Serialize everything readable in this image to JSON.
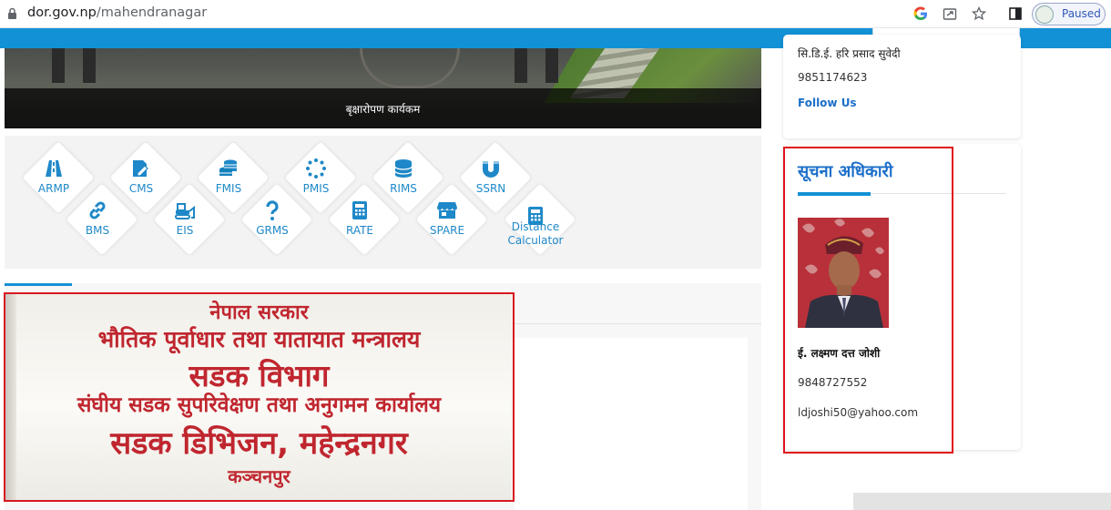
{
  "browser": {
    "url_host": "dor.gov.np",
    "url_path": "/mahendranagar",
    "profile_status": "Paused",
    "icons": [
      "lock-icon",
      "google-icon",
      "share-icon",
      "star-icon",
      "sidebar-icon",
      "profile-avatar"
    ]
  },
  "banner": {
    "caption": "बृक्षारोपण कार्यकम"
  },
  "links": [
    {
      "label": "ARMP",
      "icon": "road-icon"
    },
    {
      "label": "CMS",
      "icon": "edit-document-icon"
    },
    {
      "label": "FMIS",
      "icon": "coins-icon"
    },
    {
      "label": "PMIS",
      "icon": "spinner-icon"
    },
    {
      "label": "RIMS",
      "icon": "database-icon"
    },
    {
      "label": "SSRN",
      "icon": "magnet-icon"
    },
    {
      "label": "BMS",
      "icon": "link-icon"
    },
    {
      "label": "EIS",
      "icon": "bulldozer-icon"
    },
    {
      "label": "GRMS",
      "icon": "question-icon"
    },
    {
      "label": "RATE",
      "icon": "calculator-icon"
    },
    {
      "label": "SPARE",
      "icon": "store-icon"
    },
    {
      "label": "Distance Calculator",
      "icon": "calculator-icon"
    }
  ],
  "signboard": {
    "line1": "नेपाल सरकार",
    "line2": "भौतिक पूर्वाधार तथा यातायात मन्त्रालय",
    "line3": "सडक विभाग",
    "line4": "संघीय सडक सुपरिवेक्षण तथा अनुगमन कार्यालय",
    "line5": "सडक डिभिजन, महेन्द्रनगर",
    "line6": "कञ्चनपुर"
  },
  "contact_card": {
    "name": "सि.डि.ई. हरि प्रसाद सुवेदी",
    "phone": "9851174623",
    "follow": "Follow Us"
  },
  "info_officer": {
    "title": "सूचना अधिकारी",
    "name": "ई. लक्ष्मण दत्त जोशी",
    "phone": "9848727552",
    "email": "ldjoshi50@yahoo.com"
  },
  "colors": {
    "nav_blue": "#1391d6",
    "link_blue": "#1e88c8",
    "heading_blue": "#1b6fc9",
    "highlight_red": "#e0121b"
  }
}
